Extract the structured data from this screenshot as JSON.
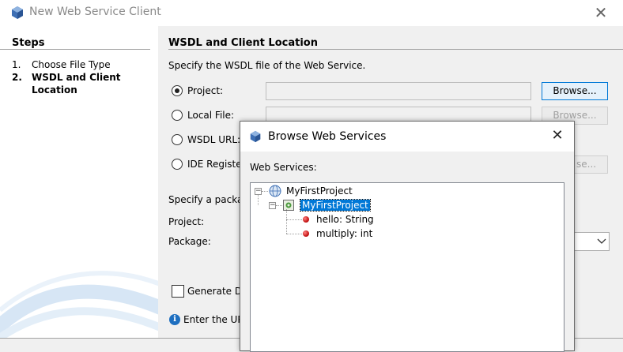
{
  "main_window": {
    "title": "New Web Service Client",
    "steps": {
      "heading": "Steps",
      "items": [
        {
          "num": "1.",
          "label": "Choose File Type"
        },
        {
          "num": "2.",
          "label": "WSDL and Client",
          "label2": "Location"
        }
      ]
    },
    "section_title": "WSDL and Client Location",
    "instruction": "Specify the WSDL file of the Web Service.",
    "options": [
      {
        "label": "Project:",
        "button": "Browse..."
      },
      {
        "label": "Local File:",
        "button": "Browse..."
      },
      {
        "label": "WSDL URL:"
      },
      {
        "label": "IDE Registe",
        "button": "se..."
      }
    ],
    "package_intro": "Specify a packa",
    "project_label": "Project:",
    "package_label": "Package:",
    "generate_label": "Generate Di",
    "info_text": "Enter the UR"
  },
  "dialog": {
    "title": "Browse Web Services",
    "label": "Web Services:",
    "tree": {
      "root": "MyFirstProject",
      "child": "MyFirstProject",
      "methods": [
        "hello: String",
        "multiply: int"
      ]
    }
  },
  "colors": {
    "selection": "#0078d7",
    "method_dot": "#c01010",
    "info_icon": "#1e6fc0"
  },
  "icons": [
    "app-icon",
    "close-icon",
    "globe-icon",
    "web-service-icon",
    "method-icon",
    "info-icon",
    "chevron-down-icon"
  ]
}
